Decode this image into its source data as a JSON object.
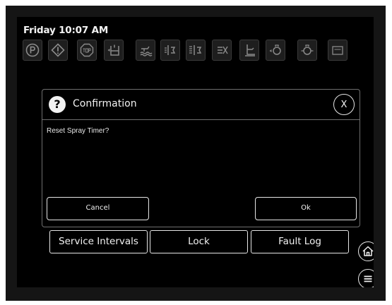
{
  "header": {
    "datetime": "Friday 10:07 AM"
  },
  "toolbar": {
    "icons": [
      "parking-brake-icon",
      "warning-icon",
      "stop-icon",
      "tank-level-icon",
      "spray-boom-icon",
      "section-control-icon",
      "multi-section-icon",
      "nozzle-off-icon",
      "hitch-icon",
      "pump-icon",
      "engine-icon",
      "gauge-icon"
    ]
  },
  "dialog": {
    "title": "Confirmation",
    "close_label": "X",
    "message": "Reset Spray Timer?",
    "cancel_label": "Cancel",
    "ok_label": "Ok"
  },
  "bottom_nav": {
    "service_intervals": "Service Intervals",
    "lock": "Lock",
    "fault_log": "Fault Log"
  },
  "side_buttons": [
    "home-icon",
    "menu-icon"
  ]
}
